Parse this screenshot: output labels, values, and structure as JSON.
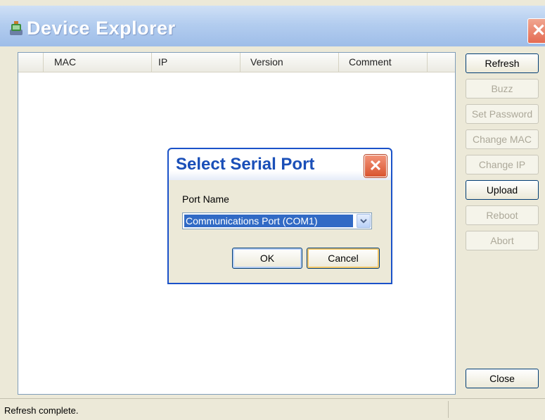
{
  "window": {
    "title": "Device Explorer",
    "close_glyph": "✕"
  },
  "list": {
    "columns": [
      "MAC",
      "IP",
      "Version",
      "Comment"
    ]
  },
  "buttons": {
    "refresh": "Refresh",
    "buzz": "Buzz",
    "set_password": "Set Password",
    "change_mac": "Change MAC",
    "change_ip": "Change IP",
    "upload": "Upload",
    "reboot": "Reboot",
    "abort": "Abort",
    "close": "Close"
  },
  "status": {
    "text": "Refresh complete."
  },
  "dialog": {
    "title": "Select Serial Port",
    "close_glyph": "✕",
    "port_label": "Port Name",
    "port_value": "Communications Port (COM1)",
    "ok": "OK",
    "cancel": "Cancel"
  },
  "colors": {
    "accent": "#316ac5",
    "dialog_title": "#1a4fb8",
    "close_red": "#e46b52"
  },
  "icons": [
    "app-icon",
    "close-icon",
    "dropdown-arrow-icon"
  ]
}
